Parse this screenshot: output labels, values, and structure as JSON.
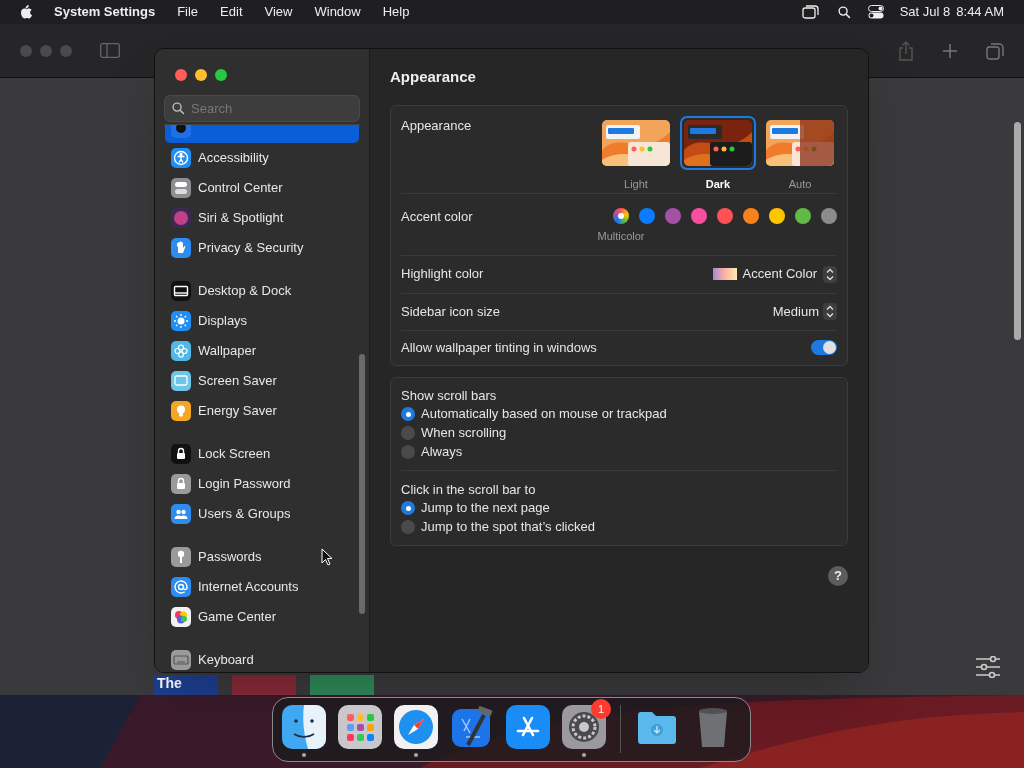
{
  "menu_bar": {
    "app_name": "System Settings",
    "menus": [
      "File",
      "Edit",
      "View",
      "Window",
      "Help"
    ],
    "date": "Sat Jul 8",
    "time": "8:44 AM"
  },
  "background_window": {
    "tiles": [
      {
        "label": "The",
        "color": "#1d3f8f"
      },
      {
        "color": "#8a2a3a"
      },
      {
        "color": "#2f8a5a"
      }
    ]
  },
  "settings": {
    "title": "Appearance",
    "search": {
      "placeholder": "Search"
    },
    "sidebar": [
      {
        "items": [
          {
            "selected": true
          },
          {
            "label": "Accessibility",
            "selected": false
          },
          {
            "label": "Control Center",
            "selected": false
          },
          {
            "label": "Siri & Spotlight",
            "selected": false
          },
          {
            "label": "Privacy & Security",
            "selected": false
          }
        ]
      },
      {
        "items": [
          {
            "label": "Desktop & Dock",
            "selected": false
          },
          {
            "label": "Displays",
            "selected": false
          },
          {
            "label": "Wallpaper",
            "selected": false
          },
          {
            "label": "Screen Saver",
            "selected": false
          },
          {
            "label": "Energy Saver",
            "selected": false
          }
        ]
      },
      {
        "items": [
          {
            "label": "Lock Screen",
            "selected": false
          },
          {
            "label": "Login Password",
            "selected": false
          },
          {
            "label": "Users & Groups",
            "selected": false
          }
        ]
      },
      {
        "items": [
          {
            "label": "Passwords",
            "selected": false
          },
          {
            "label": "Internet Accounts",
            "selected": false
          },
          {
            "label": "Game Center",
            "selected": false
          }
        ]
      },
      {
        "items": [
          {
            "label": "Keyboard",
            "selected": false
          }
        ]
      }
    ],
    "appearance": {
      "label": "Appearance",
      "options": [
        {
          "label": "Light",
          "selected": false
        },
        {
          "label": "Dark",
          "selected": true
        },
        {
          "label": "Auto",
          "selected": false
        }
      ]
    },
    "accent": {
      "label": "Accent color",
      "colors": [
        {
          "kind": "multicolor",
          "label": "Multicolor",
          "selected": true
        },
        {
          "kind": "solid",
          "color": "#0a7aff",
          "selected": false
        },
        {
          "kind": "solid",
          "color": "#a550a7",
          "selected": false
        },
        {
          "kind": "solid",
          "color": "#f74f9e",
          "selected": false
        },
        {
          "kind": "solid",
          "color": "#ff5257",
          "selected": false
        },
        {
          "kind": "solid",
          "color": "#f7821b",
          "selected": false
        },
        {
          "kind": "solid",
          "color": "#ffc600",
          "selected": false
        },
        {
          "kind": "solid",
          "color": "#62ba46",
          "selected": false
        },
        {
          "kind": "solid",
          "color": "#8c8c8c",
          "selected": false
        }
      ]
    },
    "highlight": {
      "label": "Highlight color",
      "value": "Accent Color"
    },
    "icon_size": {
      "label": "Sidebar icon size",
      "value": "Medium"
    },
    "tinting": {
      "label": "Allow wallpaper tinting in windows",
      "on": true
    },
    "radio_groups": [
      {
        "label": "Show scroll bars",
        "options": [
          {
            "label": "Automatically based on mouse or trackpad",
            "selected": true
          },
          {
            "label": "When scrolling",
            "selected": false
          },
          {
            "label": "Always",
            "selected": false
          }
        ]
      },
      {
        "label": "Click in the scroll bar to",
        "options": [
          {
            "label": "Jump to the next page",
            "selected": true
          },
          {
            "label": "Jump to the spot that’s clicked",
            "selected": false
          }
        ]
      }
    ],
    "help": "?"
  },
  "dock": [
    {
      "kind": "finder",
      "running": true
    },
    {
      "kind": "launchpad",
      "running": false
    },
    {
      "kind": "safari",
      "running": true
    },
    {
      "kind": "xcode",
      "running": false
    },
    {
      "kind": "appstore",
      "running": false
    },
    {
      "kind": "settings",
      "running": true,
      "badge": "1"
    },
    {
      "kind": "separator"
    },
    {
      "kind": "downloads",
      "running": false
    },
    {
      "kind": "trash",
      "running": false
    }
  ]
}
